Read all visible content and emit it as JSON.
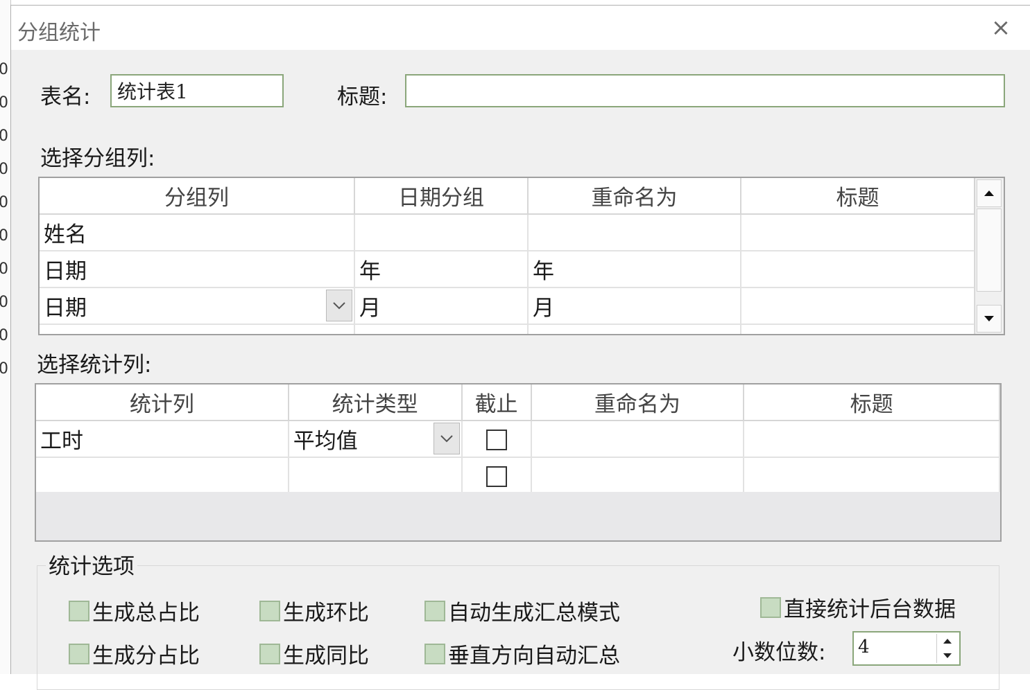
{
  "left_strip": [
    "0",
    "0",
    "0",
    "0",
    "0",
    "0",
    "0",
    "0",
    "0",
    "0"
  ],
  "dialog": {
    "title": "分组统计",
    "close_glyph": "×"
  },
  "form": {
    "table_name_label": "表名:",
    "table_name_value": "统计表1",
    "title_label": "标题:",
    "title_value": "",
    "group_section_label": "选择分组列:",
    "stat_section_label": "选择统计列:"
  },
  "group_grid": {
    "headers": [
      "分组列",
      "日期分组",
      "重命名为",
      "标题"
    ],
    "rows": [
      [
        "姓名",
        "",
        "",
        ""
      ],
      [
        "日期",
        "年",
        "年",
        ""
      ],
      [
        "日期",
        "月",
        "月",
        ""
      ]
    ]
  },
  "stat_grid": {
    "headers": [
      "统计列",
      "统计类型",
      "截止",
      "重命名为",
      "标题"
    ],
    "rows": [
      {
        "column": "工时",
        "type": "平均值",
        "cutoff": false,
        "rename": "",
        "title": ""
      },
      {
        "column": "",
        "type": "",
        "cutoff": false,
        "rename": "",
        "title": ""
      }
    ]
  },
  "options": {
    "group_title": "统计选项",
    "gen_total_ratio": "生成总占比",
    "gen_sub_ratio": "生成分占比",
    "gen_mom": "生成环比",
    "gen_yoy": "生成同比",
    "auto_summary_mode": "自动生成汇总模式",
    "vertical_auto_summary": "垂直方向自动汇总",
    "direct_backend_stats": "直接统计后台数据",
    "decimal_label": "小数位数:",
    "decimal_value": "4"
  },
  "colors": {
    "accent_border": "#8aa67a",
    "checkbox_fill": "#c8dcc2"
  }
}
